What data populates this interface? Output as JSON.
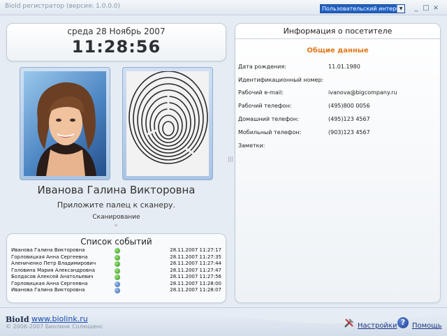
{
  "window": {
    "title": "BioId регистратор (версия: 1.0.0.0)",
    "ui_mode": "Пользовательский интерфейс",
    "min_glyph": "_",
    "max_glyph": "□",
    "close_glyph": "×"
  },
  "clock": {
    "date": "среда 28 Ноябрь 2007",
    "time": "11:28:56"
  },
  "visitor": {
    "name": "Иванова Галина Викторовна",
    "scanner_hint": "Приложите палец к сканеру.",
    "status": "Сканирование"
  },
  "events": {
    "title": "Список событий",
    "rows": [
      {
        "name": "Иванова Галина Викторовна",
        "icon": "check-icon",
        "time": "28.11.2007 11:27:17"
      },
      {
        "name": "Горловицкая Анна Сергеевна",
        "icon": "check-icon",
        "time": "28.11.2007 11:27:35"
      },
      {
        "name": "Алениченко Петр Владимирович",
        "icon": "check-icon",
        "time": "28.11.2007 11:27:44"
      },
      {
        "name": "Головина Мария Александровна",
        "icon": "check-icon",
        "time": "28.11.2007 11:27:47"
      },
      {
        "name": "Болдасов Алексей Анатольевич",
        "icon": "check-icon",
        "time": "28.11.2007 11:27:56"
      },
      {
        "name": "Горловицкая Анна Сергеевна",
        "icon": "info-icon",
        "time": "28.11.2007 11:28:00"
      },
      {
        "name": "Иванова Галина Викторовна",
        "icon": "info-icon",
        "time": "28.11.2007 11:28:07"
      }
    ]
  },
  "info": {
    "title": "Информация о посетителе",
    "section": "Общие данные",
    "fields": [
      {
        "label": "Дата рождения:",
        "value": "11.01.1980"
      },
      {
        "label": "Идентификационный номер:",
        "value": ""
      },
      {
        "label": "Рабочий e-mail:",
        "value": "ivanova@bigcompany.ru"
      },
      {
        "label": "Рабочий телефон:",
        "value": "(495)800 0056"
      },
      {
        "label": "Домашний телефон:",
        "value": "(495)123 4567"
      },
      {
        "label": "Мобильный телефон:",
        "value": "(903)123 4567"
      },
      {
        "label": "Заметки:",
        "value": ""
      }
    ]
  },
  "footer": {
    "brand": "BioId",
    "site": "www.biolink.ru",
    "copyright": "© 2006-2007 Биолинк Солюшенс",
    "settings": "Настройки",
    "help": "Помощь"
  },
  "colors": {
    "accent": "#e0781c",
    "link": "#1b4ab3",
    "ok": "#2f9a1f",
    "info": "#2e5fae"
  }
}
